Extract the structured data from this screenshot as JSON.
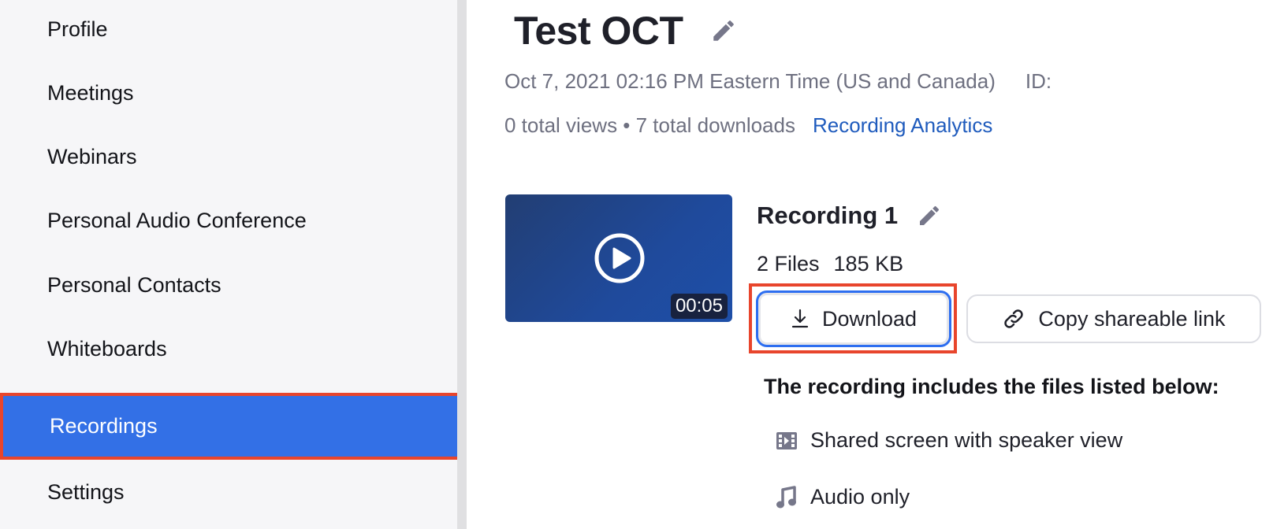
{
  "sidebar": {
    "items": [
      {
        "label": "Profile",
        "active": false
      },
      {
        "label": "Meetings",
        "active": false
      },
      {
        "label": "Webinars",
        "active": false
      },
      {
        "label": "Personal Audio Conference",
        "active": false
      },
      {
        "label": "Personal Contacts",
        "active": false
      },
      {
        "label": "Whiteboards",
        "active": false
      },
      {
        "label": "Recordings",
        "active": true
      },
      {
        "label": "Settings",
        "active": false
      }
    ]
  },
  "meeting": {
    "title": "Test OCT",
    "datetime": "Oct 7, 2021 02:16 PM Eastern Time (US and Canada)",
    "id_label": "ID: ",
    "stats": "0 total views • 7 total downloads",
    "analytics_link": "Recording Analytics"
  },
  "recording": {
    "title": "Recording 1",
    "file_count": "2 Files",
    "size": "185 KB",
    "duration": "00:05",
    "download_label": "Download",
    "copy_link_label": "Copy shareable link",
    "files_heading": "The recording includes the files listed below:",
    "files": [
      {
        "icon": "video-file-icon",
        "label": "Shared screen with speaker view"
      },
      {
        "icon": "audio-file-icon",
        "label": "Audio only"
      }
    ]
  },
  "colors": {
    "accent": "#3370e6",
    "highlight": "#e8452c",
    "link": "#1f5bbd"
  }
}
